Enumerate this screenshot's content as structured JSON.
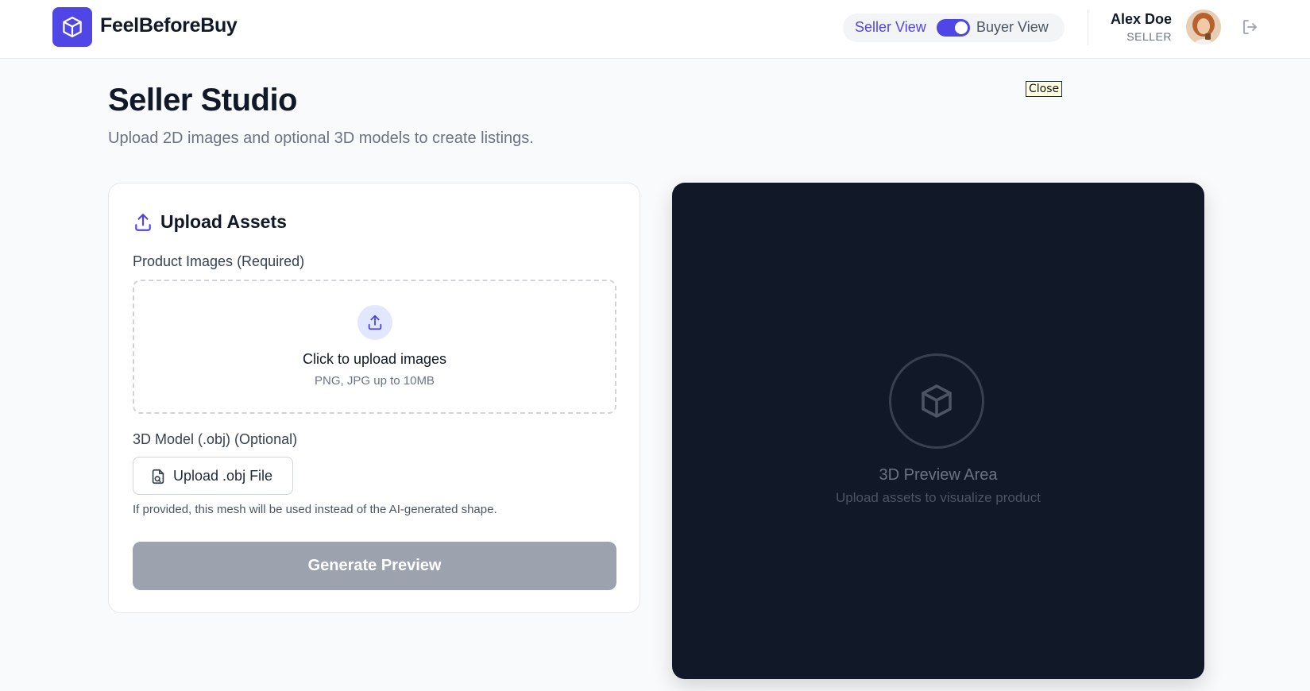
{
  "header": {
    "brand": "FeelBeforeBuy",
    "view_toggle": {
      "seller_label": "Seller View",
      "buyer_label": "Buyer View",
      "active": "Seller View"
    },
    "user": {
      "name": "Alex Doe",
      "role": "SELLER"
    }
  },
  "tooltip": {
    "text": "Close"
  },
  "page": {
    "title": "Seller Studio",
    "subtitle": "Upload 2D images and optional 3D models to create listings."
  },
  "upload_card": {
    "title": "Upload Assets",
    "images_label": "Product Images (Required)",
    "dropzone_title": "Click to upload images",
    "dropzone_hint": "PNG, JPG up to 10MB",
    "obj_label": "3D Model (.obj) (Optional)",
    "obj_button": "Upload .obj File",
    "obj_help": "If provided, this mesh will be used instead of the AI-generated shape.",
    "generate_button": "Generate Preview"
  },
  "preview": {
    "title": "3D Preview Area",
    "subtitle": "Upload assets to visualize product"
  },
  "colors": {
    "accent": "#4f46e5",
    "disabled_button": "#9ca3af",
    "preview_bg": "#111827"
  },
  "icons": [
    "cube-icon",
    "upload-icon",
    "file-icon",
    "logout-icon"
  ]
}
